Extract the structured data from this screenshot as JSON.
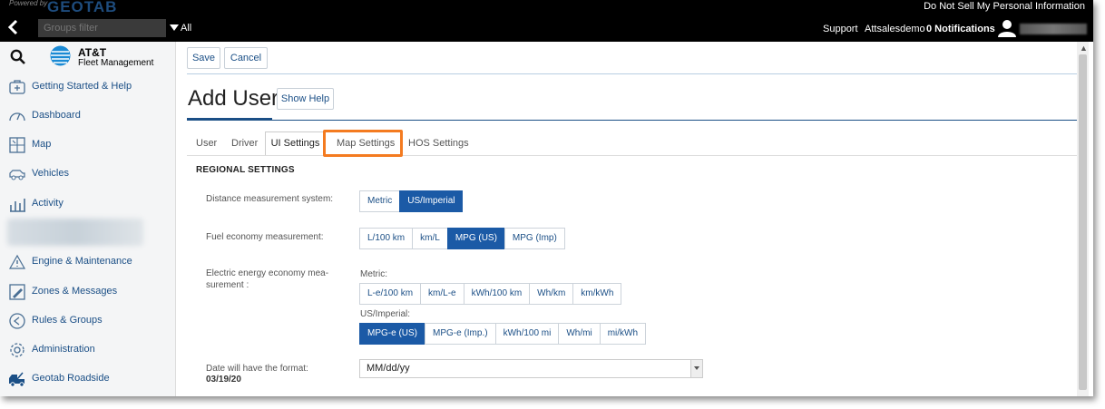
{
  "topbar": {
    "powered_by": "Powered by",
    "brand": "GEOTAB",
    "do_not_sell": "Do Not Sell My Personal Information",
    "groups_filter_placeholder": "Groups filter",
    "all_label": "All",
    "support": "Support",
    "account": "Attsalesdemo",
    "notifications": "0 Notifications"
  },
  "sidebar": {
    "logo_line1": "AT&T",
    "logo_line2": "Fleet Management",
    "items": [
      {
        "label": "Getting Started & Help",
        "icon": "help-kit-icon"
      },
      {
        "label": "Dashboard",
        "icon": "gauge-icon"
      },
      {
        "label": "Map",
        "icon": "map-icon"
      },
      {
        "label": "Vehicles",
        "icon": "vehicle-icon"
      },
      {
        "label": "Activity",
        "icon": "activity-chart-icon"
      },
      {
        "label": "Engine & Maintenance",
        "icon": "engine-warning-icon"
      },
      {
        "label": "Zones & Messages",
        "icon": "zones-edit-icon"
      },
      {
        "label": "Rules & Groups",
        "icon": "rules-icon"
      },
      {
        "label": "Administration",
        "icon": "gear-icon"
      },
      {
        "label": "Geotab Roadside",
        "icon": "tow-truck-icon"
      }
    ]
  },
  "toolbar": {
    "save_label": "Save",
    "cancel_label": "Cancel"
  },
  "page": {
    "title": "Add User",
    "show_help": "Show Help"
  },
  "tabs": {
    "user": "User",
    "driver": "Driver",
    "ui_settings": "UI Settings",
    "map_settings": "Map Settings",
    "hos_settings": "HOS Settings"
  },
  "regional": {
    "heading": "REGIONAL SETTINGS",
    "distance_label": "Distance measurement system:",
    "distance_options": [
      "Metric",
      "US/Imperial"
    ],
    "distance_selected": "US/Imperial",
    "fuel_label": "Fuel economy measurement:",
    "fuel_options": [
      "L/100 km",
      "km/L",
      "MPG (US)",
      "MPG (Imp)"
    ],
    "fuel_selected": "MPG (US)",
    "electric_label": "Electric energy economy mea-\nsurement :",
    "metric_sublabel": "Metric:",
    "metric_options": [
      "L-e/100 km",
      "km/L-e",
      "kWh/100 km",
      "Wh/km",
      "km/kWh"
    ],
    "imperial_sublabel": "US/Imperial:",
    "imperial_options": [
      "MPG-e (US)",
      "MPG-e (Imp.)",
      "kWh/100 mi",
      "Wh/mi",
      "mi/kWh"
    ],
    "imperial_selected": "MPG-e (US)",
    "date_label": "Date will have the format:",
    "date_example": "03/19/20",
    "date_format_value": "MM/dd/yy"
  },
  "colors": {
    "accent": "#1b5aa6",
    "highlight": "#f47b20",
    "link": "#1b4f86"
  }
}
